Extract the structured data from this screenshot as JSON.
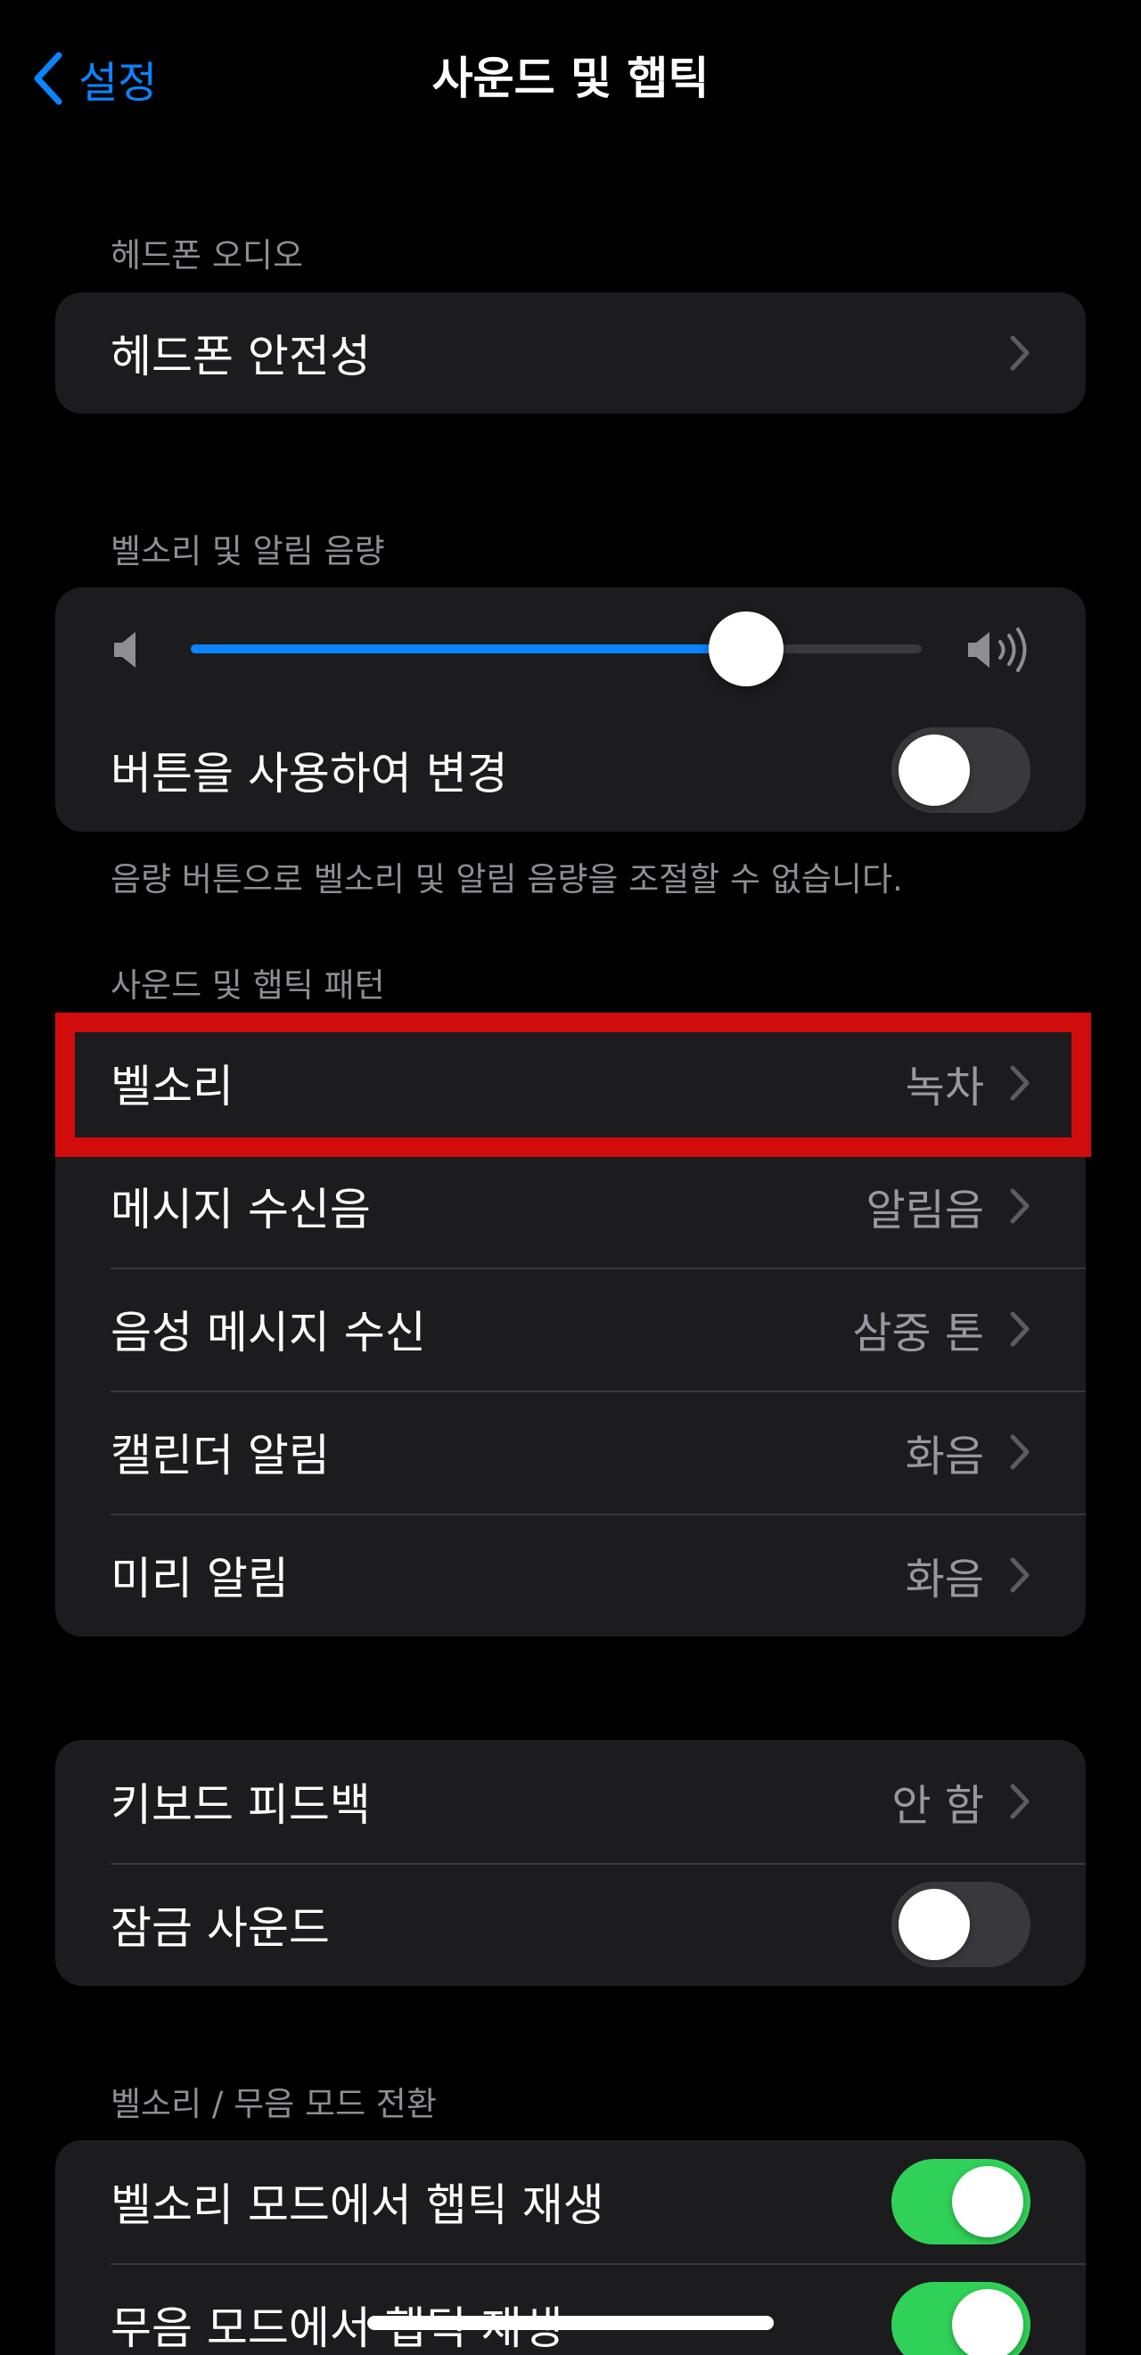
{
  "nav": {
    "back_label": "설정",
    "title": "사운드 및 햅틱"
  },
  "headphone": {
    "header": "헤드폰 오디오",
    "row_label": "헤드폰 안전성"
  },
  "volume": {
    "header": "벨소리 및 알림 음량",
    "slider_level": 0.76,
    "change_with_buttons_label": "버튼을 사용하여 변경",
    "change_with_buttons_on": false,
    "footer": "음량 버튼으로 벨소리 및 알림 음량을 조절할 수 없습니다."
  },
  "patterns": {
    "header": "사운드 및 햅틱 패턴",
    "rows": [
      {
        "label": "벨소리",
        "value": "녹차"
      },
      {
        "label": "메시지 수신음",
        "value": "알림음"
      },
      {
        "label": "음성 메시지 수신",
        "value": "삼중 톤"
      },
      {
        "label": "캘린더 알림",
        "value": "화음"
      },
      {
        "label": "미리 알림",
        "value": "화음"
      }
    ]
  },
  "system": {
    "keyboard_label": "키보드 피드백",
    "keyboard_value": "안 함",
    "lock_sound_label": "잠금 사운드",
    "lock_sound_on": false
  },
  "silent_mode": {
    "header": "벨소리 / 무음 모드 전환",
    "ring_haptics_label": "벨소리 모드에서 햅틱 재생",
    "ring_haptics_on": true,
    "silent_haptics_label": "무음 모드에서 햅틱 재생",
    "silent_haptics_on": true
  },
  "colors": {
    "accent": "#0a84ff",
    "highlight": "#d10c0c",
    "toggle_on": "#30d158",
    "cell_background": "#1c1c1e"
  },
  "icons": [
    "chevron-left-icon",
    "chevron-right-icon",
    "speaker-low-icon",
    "speaker-high-icon"
  ]
}
